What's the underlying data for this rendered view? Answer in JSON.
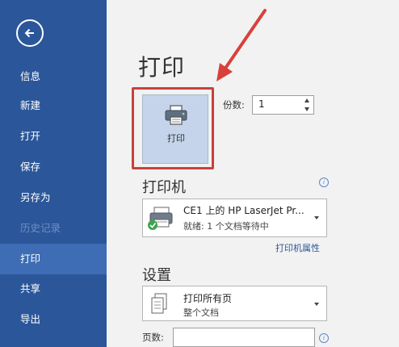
{
  "sidebar": {
    "items": [
      {
        "label": "信息"
      },
      {
        "label": "新建"
      },
      {
        "label": "打开"
      },
      {
        "label": "保存"
      },
      {
        "label": "另存为"
      },
      {
        "label": "历史记录"
      },
      {
        "label": "打印"
      },
      {
        "label": "共享"
      },
      {
        "label": "导出"
      }
    ],
    "active_item": "打印",
    "disabled_item": "历史记录"
  },
  "main": {
    "title": "打印",
    "print_button_label": "打印",
    "copies_label": "份数:",
    "copies_value": "1",
    "printer_section_title": "打印机",
    "printer_name": "CE1 上的 HP LaserJet Pr...",
    "printer_status": "就绪: 1 个文档等待中",
    "printer_properties_link": "打印机属性",
    "settings_section_title": "设置",
    "range_main": "打印所有页",
    "range_sub": "整个文档",
    "pages_label": "页数:",
    "pages_value": ""
  },
  "colors": {
    "sidebar_bg": "#2b579a",
    "sidebar_active": "#3e6db6",
    "highlight": "#c8413a",
    "annotation_arrow": "#d8413a",
    "link": "#2b579a"
  },
  "icons": {
    "back": "back-arrow-icon",
    "printer": "printer-icon",
    "printer_ready": "printer-ready-icon",
    "pages": "pages-icon",
    "info": "info-icon"
  }
}
